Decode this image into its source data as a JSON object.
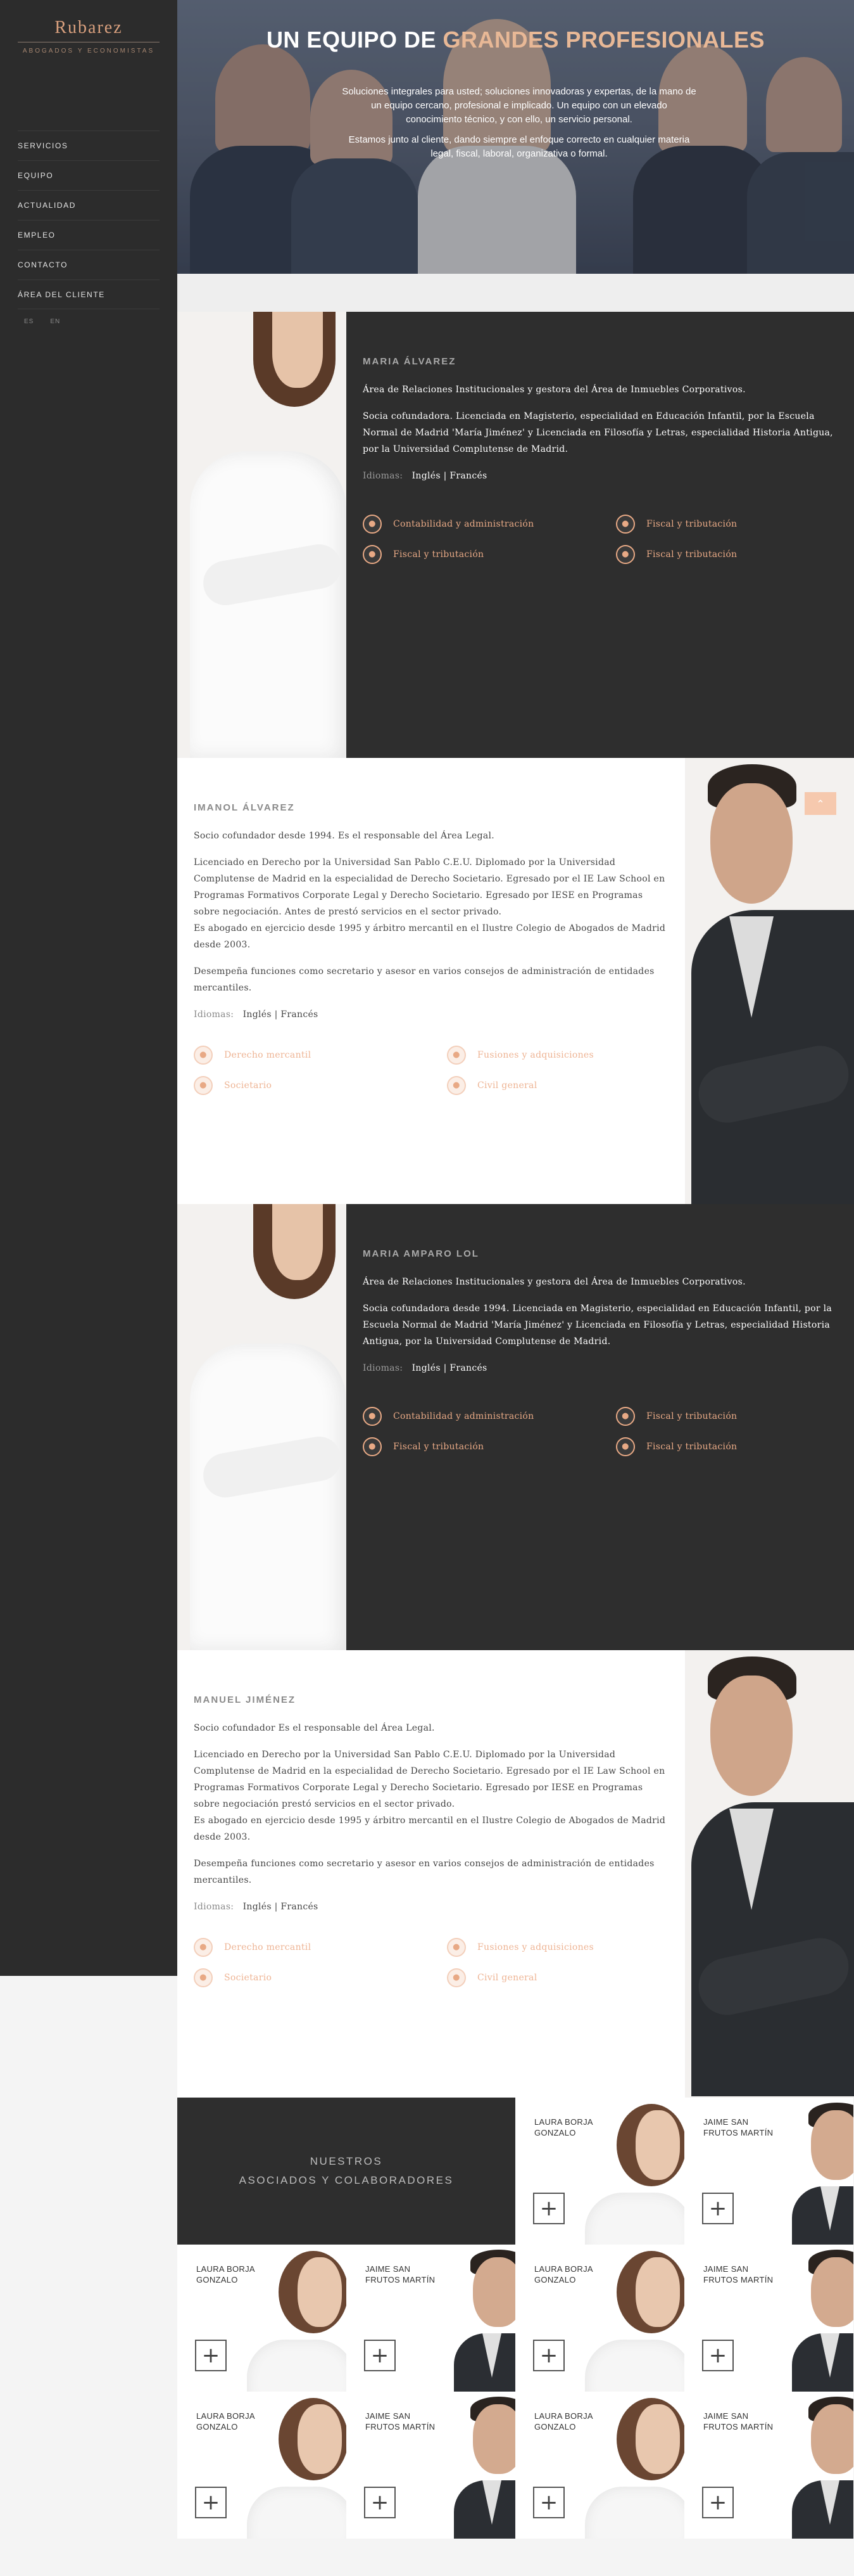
{
  "brand": {
    "name": "Rubarez",
    "tagline": "ABOGADOS Y ECONOMISTAS"
  },
  "nav": {
    "items": [
      "SERVICIOS",
      "EQUIPO",
      "ACTUALIDAD",
      "EMPLEO",
      "CONTACTO",
      "ÁREA DEL CLIENTE"
    ],
    "languages": [
      "ES",
      "EN"
    ]
  },
  "hero": {
    "title_prefix": "UN EQUIPO DE ",
    "title_accent": "GRANDES PROFESIONALES",
    "paragraph1": "Soluciones integrales para usted; soluciones innovadoras y expertas, de la mano de un equipo cercano, profesional e implicado. Un equipo con un elevado conocimiento técnico, y con ello, un servicio personal.",
    "paragraph2": "Estamos junto al cliente, dando siempre el enfoque correcto en cualquier materia legal, fiscal, laboral, organizativa o formal."
  },
  "languages_label": "Idiomas:",
  "members": [
    {
      "name": "MARIA ÁLVAREZ",
      "paragraphs": [
        "Área de Relaciones Institucionales y gestora del Área de Inmuebles Corporativos.",
        "Socia cofundadora. Licenciada en Magisterio, especialidad en Educación Infantil, por la Escuela Normal de Madrid 'María Jiménez' y Licenciada en Filosofía y Letras, especialidad Historia Antigua, por la Universidad Complutense de Madrid."
      ],
      "languages": "Inglés | Francés",
      "areas": [
        "Contabilidad y administración",
        "Fiscal y tributación",
        "Fiscal y tributación",
        "Fiscal y tributación"
      ]
    },
    {
      "name": "IMANOL ÁLVAREZ",
      "paragraphs": [
        "Socio cofundador desde 1994. Es el responsable del Área Legal.",
        "Licenciado en Derecho por la Universidad San Pablo C.E.U. Diplomado por la Universidad Complutense de Madrid en la especialidad de Derecho Societario. Egresado por el IE Law School en Programas Formativos Corporate Legal y Derecho Societario. Egresado por IESE en Programas sobre negociación. Antes de prestó servicios en el sector privado.\nEs abogado en ejercicio desde 1995 y árbitro mercantil en el Ilustre Colegio de Abogados de Madrid desde 2003.",
        "Desempeña funciones como secretario y asesor en varios consejos de administración de entidades mercantiles."
      ],
      "languages": "Inglés | Francés",
      "areas": [
        "Derecho mercantil",
        "Fusiones y adquisiciones",
        "Societario",
        "Civil general"
      ]
    },
    {
      "name": "MARIA AMPARO LOL",
      "paragraphs": [
        "Área de Relaciones Institucionales y gestora del Área de Inmuebles Corporativos.",
        "Socia cofundadora desde 1994. Licenciada en Magisterio, especialidad en Educación Infantil, por la Escuela Normal de Madrid 'María Jiménez' y Licenciada en Filosofía y Letras, especialidad Historia Antigua, por la Universidad Complutense de Madrid."
      ],
      "languages": "Inglés | Francés",
      "areas": [
        "Contabilidad y administración",
        "Fiscal y tributación",
        "Fiscal y tributación",
        "Fiscal y tributación"
      ]
    },
    {
      "name": "MANUEL JIMÉNEZ",
      "paragraphs": [
        "Socio cofundador Es el responsable del Área Legal.",
        "Licenciado en Derecho por la Universidad San Pablo C.E.U. Diplomado por la Universidad Complutense de Madrid en la especialidad de Derecho Societario. Egresado por el IE Law School en Programas Formativos Corporate Legal y Derecho Societario. Egresado por IESE en Programas sobre negociación prestó servicios en el sector privado.\nEs abogado en ejercicio desde 1995 y árbitro mercantil en el Ilustre Colegio de Abogados de Madrid desde 2003.",
        "Desempeña funciones como secretario y asesor en varios consejos de administración de entidades mercantiles."
      ],
      "languages": "Inglés | Francés",
      "areas": [
        "Derecho mercantil",
        "Fusiones y adquisiciones",
        "Societario",
        "Civil general"
      ]
    }
  ],
  "associates": {
    "heading_line1": "NUESTROS",
    "heading_line2": "ASOCIADOS Y COLABORADORES",
    "tiles": [
      {
        "name": "LAURA BORJA GONZALO",
        "kind": "woman"
      },
      {
        "name": "JAIME SAN FRUTOS MARTÍN",
        "kind": "man"
      },
      {
        "name": "LAURA BORJA GONZALO",
        "kind": "woman"
      },
      {
        "name": "JAIME SAN FRUTOS MARTÍN",
        "kind": "man"
      },
      {
        "name": "LAURA BORJA GONZALO",
        "kind": "woman"
      },
      {
        "name": "JAIME SAN FRUTOS MARTÍN",
        "kind": "man"
      },
      {
        "name": "LAURA BORJA GONZALO",
        "kind": "woman"
      },
      {
        "name": "JAIME SAN FRUTOS MARTÍN",
        "kind": "man"
      },
      {
        "name": "LAURA BORJA GONZALO",
        "kind": "woman"
      },
      {
        "name": "JAIME SAN FRUTOS MARTÍN",
        "kind": "man"
      }
    ],
    "plus_symbol": "+"
  },
  "icons": {
    "area": "user-icon",
    "to_top": "chevron-up-icon",
    "add": "plus-icon"
  },
  "colors": {
    "accent": "#e8a985",
    "dark": "#2e2e2e",
    "sidebar": "#2c2c2c"
  }
}
